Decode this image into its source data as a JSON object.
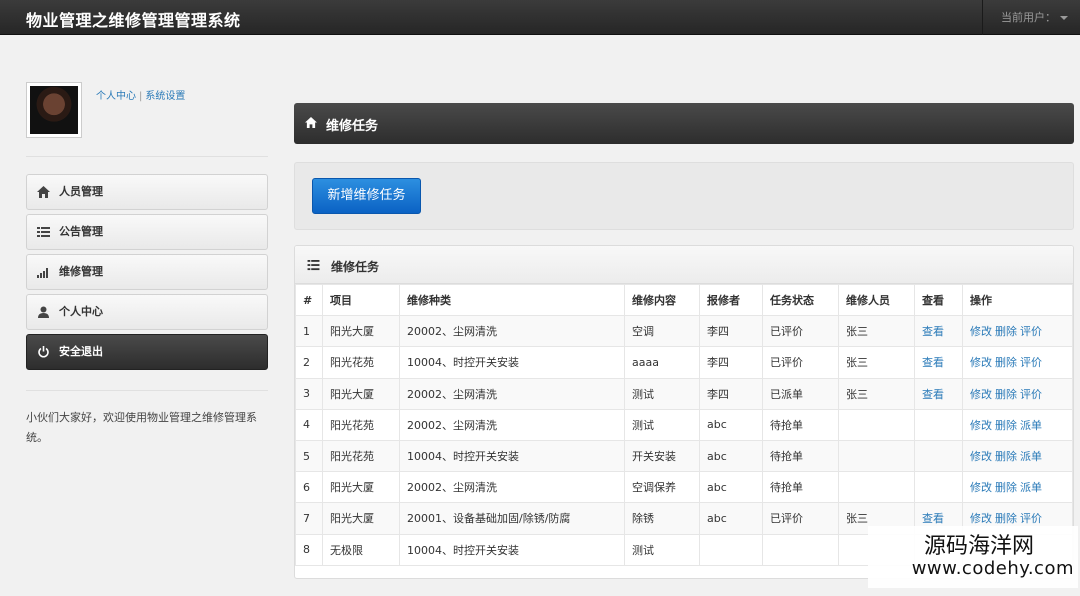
{
  "app": {
    "title": "物业管理之维修管理管理系统",
    "current_user_label": "当前用户："
  },
  "sidebar": {
    "profile_links": [
      "个人中心",
      "系统设置"
    ],
    "items": [
      {
        "label": "人员管理",
        "icon": "home-icon"
      },
      {
        "label": "公告管理",
        "icon": "list-icon"
      },
      {
        "label": "维修管理",
        "icon": "signal-bars-icon"
      },
      {
        "label": "个人中心",
        "icon": "user-icon"
      },
      {
        "label": "安全退出",
        "icon": "power-icon",
        "active": true
      }
    ],
    "welcome": "小伙们大家好，欢迎使用物业管理之维修管理系统。"
  },
  "main": {
    "page_title": "维修任务",
    "add_button": "新增维修任务",
    "table_title": "维修任务",
    "columns": [
      "#",
      "项目",
      "维修种类",
      "维修内容",
      "报修者",
      "任务状态",
      "维修人员",
      "查看",
      "操作"
    ],
    "rows": [
      {
        "no": "1",
        "project": "阳光大厦",
        "category": "20002、尘网清洗",
        "content": "空调",
        "reporter": "李四",
        "status": "已评价",
        "staff": "张三",
        "view": "查看",
        "ops": [
          "修改",
          "删除",
          "评价"
        ]
      },
      {
        "no": "2",
        "project": "阳光花苑",
        "category": "10004、时控开关安装",
        "content": "aaaa",
        "reporter": "李四",
        "status": "已评价",
        "staff": "张三",
        "view": "查看",
        "ops": [
          "修改",
          "删除",
          "评价"
        ]
      },
      {
        "no": "3",
        "project": "阳光大厦",
        "category": "20002、尘网清洗",
        "content": "测试",
        "reporter": "李四",
        "status": "已派单",
        "staff": "张三",
        "view": "查看",
        "ops": [
          "修改",
          "删除",
          "评价"
        ]
      },
      {
        "no": "4",
        "project": "阳光花苑",
        "category": "20002、尘网清洗",
        "content": "测试",
        "reporter": "abc",
        "status": "待抢单",
        "staff": "",
        "view": "",
        "ops": [
          "修改",
          "删除",
          "派单"
        ]
      },
      {
        "no": "5",
        "project": "阳光花苑",
        "category": "10004、时控开关安装",
        "content": "开关安装",
        "reporter": "abc",
        "status": "待抢单",
        "staff": "",
        "view": "",
        "ops": [
          "修改",
          "删除",
          "派单"
        ]
      },
      {
        "no": "6",
        "project": "阳光大厦",
        "category": "20002、尘网清洗",
        "content": "空调保养",
        "reporter": "abc",
        "status": "待抢单",
        "staff": "",
        "view": "",
        "ops": [
          "修改",
          "删除",
          "派单"
        ]
      },
      {
        "no": "7",
        "project": "阳光大厦",
        "category": "20001、设备基础加固/除锈/防腐",
        "content": "除锈",
        "reporter": "abc",
        "status": "已评价",
        "staff": "张三",
        "view": "查看",
        "ops": [
          "修改",
          "删除",
          "评价"
        ]
      },
      {
        "no": "8",
        "project": "无极限",
        "category": "10004、时控开关安装",
        "content": "测试",
        "reporter": "",
        "status": "",
        "staff": "",
        "view": "",
        "ops": []
      }
    ]
  },
  "watermark": {
    "name": "源码海洋网",
    "url": "www.codehy.com"
  }
}
